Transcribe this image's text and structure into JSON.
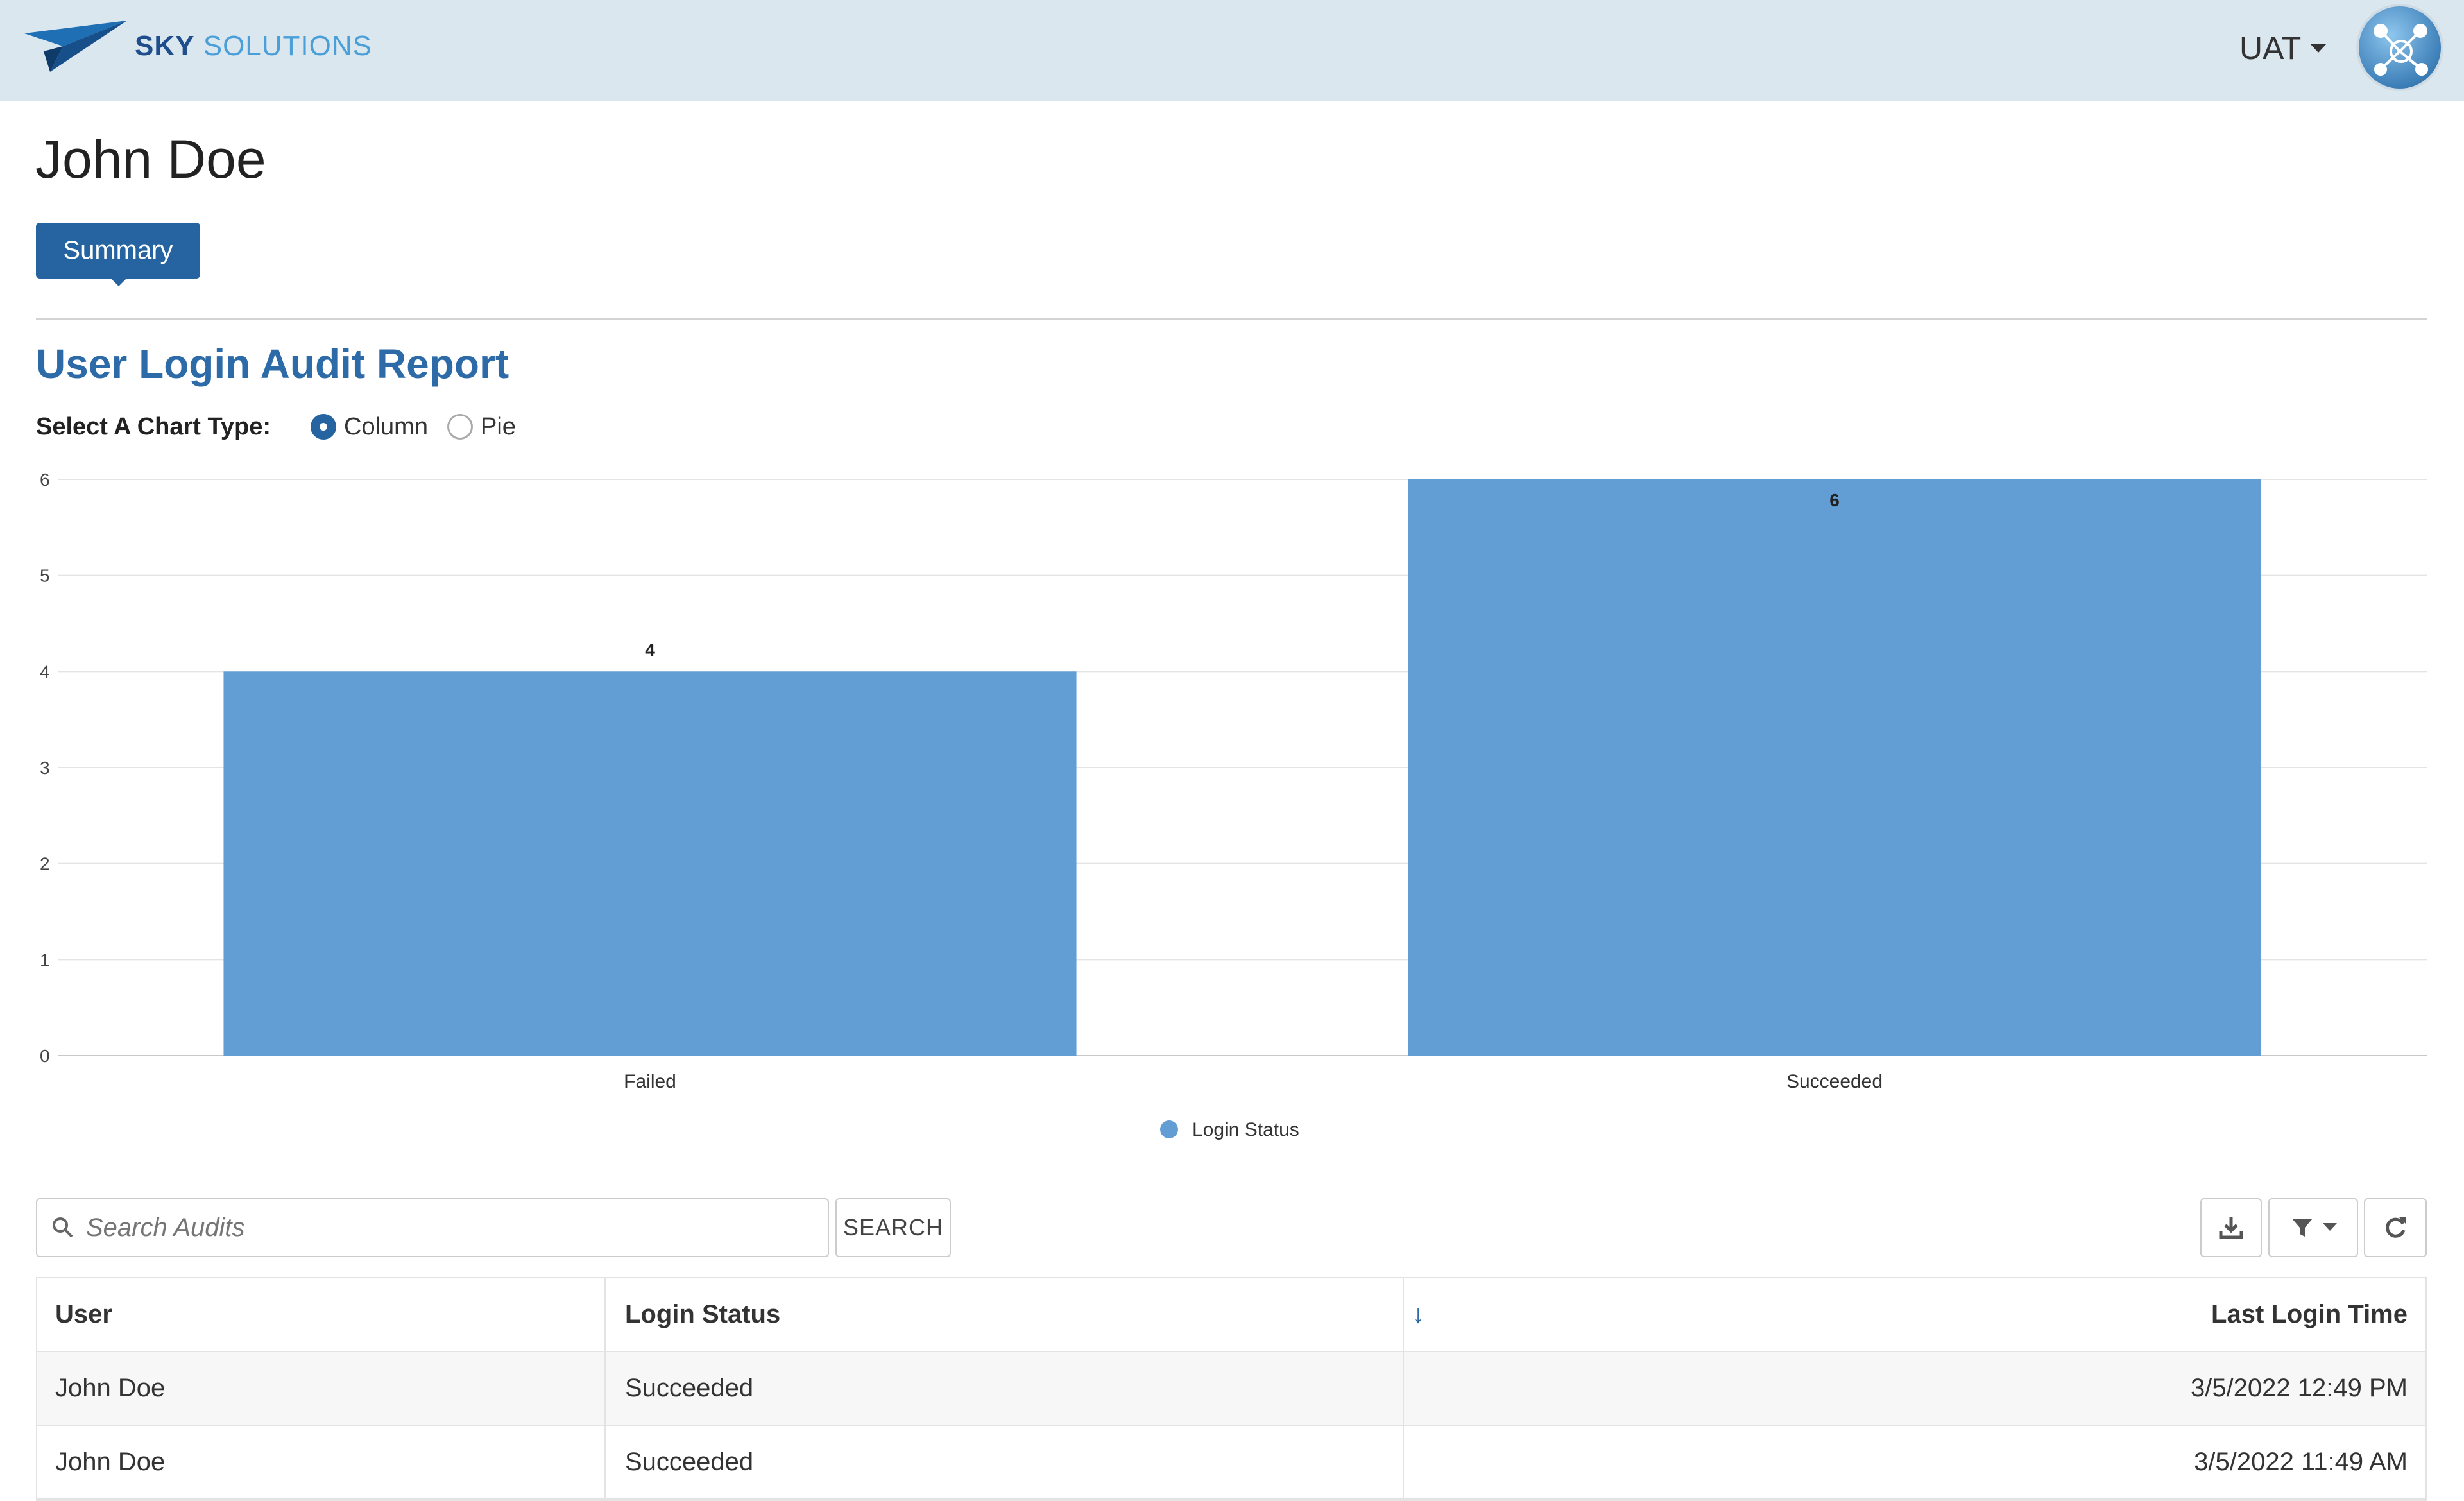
{
  "header": {
    "logo": {
      "word1": "SKY",
      "word2": "SOLUTIONS"
    },
    "environment": "UAT",
    "avatar_icon": "network-avatar-icon"
  },
  "page": {
    "title": "John Doe",
    "tabs": [
      {
        "label": "Summary",
        "active": true
      }
    ]
  },
  "report": {
    "title": "User Login Audit Report",
    "chart_type_label": "Select A Chart Type:",
    "chart_type_options": [
      {
        "label": "Column",
        "selected": true
      },
      {
        "label": "Pie",
        "selected": false
      }
    ]
  },
  "chart_data": {
    "type": "bar",
    "categories": [
      "Failed",
      "Succeeded"
    ],
    "series": [
      {
        "name": "Login Status",
        "values": [
          4,
          6
        ],
        "color": "#629ed4"
      }
    ],
    "ylim": [
      0,
      6
    ],
    "yticks": [
      0,
      1,
      2,
      3,
      4,
      5,
      6
    ],
    "data_labels": true,
    "grid": true,
    "legend": "bottom-center"
  },
  "toolbar": {
    "search_placeholder": "Search Audits",
    "search_button": "SEARCH",
    "icons": [
      "download-icon",
      "filter-icon",
      "refresh-icon"
    ]
  },
  "table": {
    "columns": [
      "User",
      "Login Status",
      "Last Login Time"
    ],
    "sort_indicator": "↓",
    "rows": [
      {
        "user": "John Doe",
        "status": "Succeeded",
        "time": "3/5/2022 12:49 PM"
      },
      {
        "user": "John Doe",
        "status": "Succeeded",
        "time": "3/5/2022 11:49 AM"
      }
    ]
  },
  "colors": {
    "header_bg": "#dbe7ef",
    "accent": "#2564a0",
    "title": "#2c6aa8",
    "bar": "#629ed4"
  }
}
